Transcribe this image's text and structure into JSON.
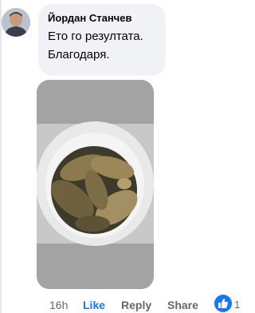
{
  "comment": {
    "author": "Йордан Станчев",
    "text_line1": "Ето го резултата.",
    "text_line2": "Благодаря.",
    "photo_icon": "fish-in-bucket-photo",
    "avatar_icon": "user-avatar"
  },
  "actions": {
    "timestamp": "16h",
    "like_label": "Like",
    "reply_label": "Reply",
    "share_label": "Share"
  },
  "reaction": {
    "icon": "thumbs-up-icon",
    "color": "#1877f2",
    "count": "1"
  }
}
